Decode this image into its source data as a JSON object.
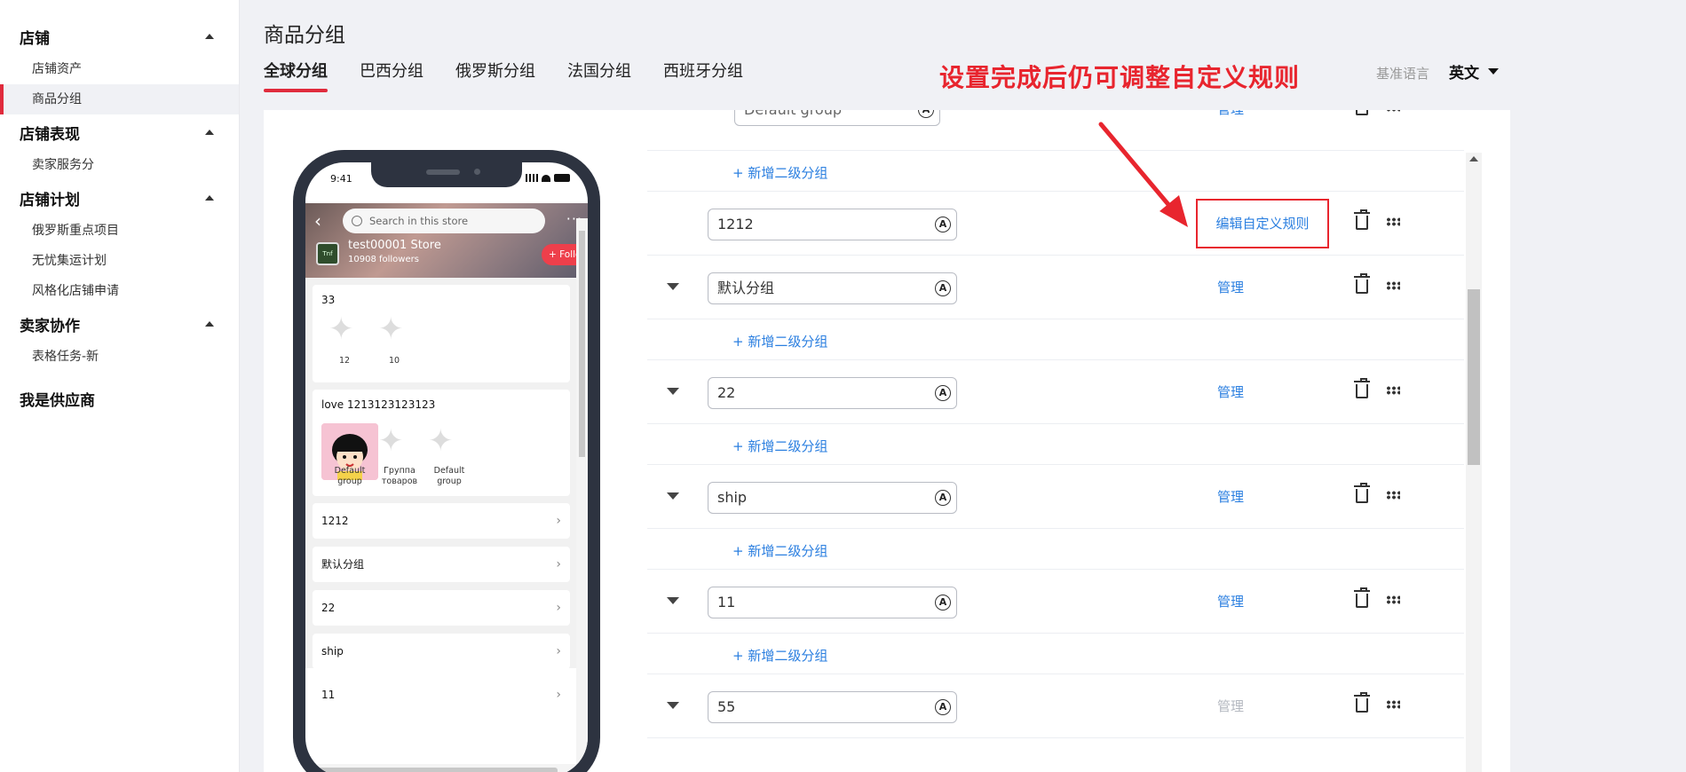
{
  "sidebar": {
    "sections": [
      {
        "label": "店铺",
        "items": [
          "店铺资产",
          "商品分组"
        ]
      },
      {
        "label": "店铺表现",
        "items": [
          "卖家服务分"
        ]
      },
      {
        "label": "店铺计划",
        "items": [
          "俄罗斯重点项目",
          "无忧集运计划",
          "风格化店铺申请"
        ]
      },
      {
        "label": "卖家协作",
        "items": [
          "表格任务-新"
        ]
      }
    ],
    "extra": "我是供应商",
    "active_item": "商品分组"
  },
  "header": {
    "title": "商品分组",
    "tabs": [
      "全球分组",
      "巴西分组",
      "俄罗斯分组",
      "法国分组",
      "西班牙分组"
    ],
    "active_tab": "全球分组",
    "annotation": "设置完成后仍可调整自定义规则",
    "base_lang_label": "基准语言",
    "base_lang_value": "英文"
  },
  "phone": {
    "time": "9:41",
    "search_placeholder": "Search in this store",
    "store_name": "test00001 Store",
    "followers": "10908 followers",
    "follow_btn": "+ Follow",
    "logo_text": "Tnf",
    "block1": {
      "title": "33",
      "captions": [
        "12",
        "10"
      ]
    },
    "block2": {
      "title": "love 1213123123123",
      "captions": [
        "Default group",
        "Группа товаров",
        "Default group"
      ]
    },
    "rows": [
      "1212",
      "默认分组",
      "22",
      "ship",
      "11"
    ]
  },
  "groups": {
    "top_partial_value": "Default group",
    "top_partial_manage": "管理",
    "sub_link": "+ 新增二级分组",
    "edit_rule": "编辑自定义规则",
    "manage": "管理",
    "items": [
      {
        "name": "1212",
        "action": "编辑自定义规则"
      },
      {
        "name": "默认分组",
        "action": "管理"
      },
      {
        "name": "22",
        "action": "管理"
      },
      {
        "name": "ship",
        "action": "管理"
      },
      {
        "name": "11",
        "action": "管理"
      },
      {
        "name": "55",
        "action": "管理"
      }
    ]
  },
  "colors": {
    "accent_red": "#e02b3c",
    "link_blue": "#2b7fe0",
    "annotation_red": "#e8252e"
  }
}
